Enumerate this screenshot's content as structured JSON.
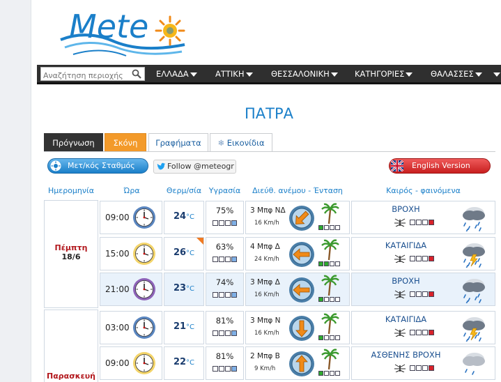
{
  "logo": {
    "text": "Mete"
  },
  "search": {
    "placeholder": "Αναζήτηση περιοχής"
  },
  "nav": {
    "items": [
      "ΕΛΛΑΔΑ",
      "ΑΤΤΙΚΗ",
      "ΘΕΣΣΑΛΟΝΙΚΗ",
      "ΚΑΤΗΓΟΡΙΕΣ",
      "ΘΑΛΑΣΣΕΣ"
    ]
  },
  "city": "ΠΑΤΡΑ",
  "tabs": [
    "Πρόγνωση",
    "Σκόνη",
    "Γραφήματα",
    "Εικονίδια"
  ],
  "buttons": {
    "stations": "Μετ/κός Σταθμός",
    "twitter": "Follow @meteogr",
    "english": "English Version"
  },
  "headers": [
    "Ημερομηνία",
    "Ώρα",
    "Θερμ/σία",
    "Υγρασία",
    "Διεύθ. ανέμου - Ένταση",
    "Καιρός - φαινόμενα"
  ],
  "days": [
    {
      "name": "Πέμπτη",
      "date": "18/6"
    },
    {
      "name": "Παρασκευή",
      "date": ""
    }
  ],
  "temp_unit": "°C",
  "rows": [
    {
      "time": "09:00",
      "temp": "24",
      "humidity": "75%",
      "hum_level": 1,
      "wind": "3 Μπφ ΝΔ",
      "speed": "16 Km/h",
      "wind_dir": "ΝΔ",
      "wind_level": 1,
      "cond": "ΒΡΟΧΗ",
      "cond_level": 1,
      "icon": "rain-icon",
      "marker": false
    },
    {
      "time": "15:00",
      "temp": "26",
      "humidity": "63%",
      "hum_level": 1,
      "wind": "4 Μπφ Δ",
      "speed": "24 Km/h",
      "wind_dir": "Δ",
      "wind_level": 2,
      "cond": "ΚΑΤΑΙΓΙΔΑ",
      "cond_level": 1,
      "icon": "thunderstorm-icon",
      "marker": true
    },
    {
      "time": "21:00",
      "temp": "23",
      "humidity": "74%",
      "hum_level": 1,
      "wind": "3 Μπφ Δ",
      "speed": "16 Km/h",
      "wind_dir": "Δ",
      "wind_level": 1,
      "cond": "ΒΡΟΧΗ",
      "cond_level": 1,
      "icon": "rain-icon",
      "marker": false
    },
    {
      "time": "03:00",
      "temp": "21",
      "humidity": "81%",
      "hum_level": 1,
      "wind": "3 Μπφ Ν",
      "speed": "16 Km/h",
      "wind_dir": "Ν",
      "wind_level": 1,
      "cond": "ΚΑΤΑΙΓΙΔΑ",
      "cond_level": 1,
      "icon": "thunderstorm-icon",
      "marker": false
    },
    {
      "time": "09:00",
      "temp": "22",
      "humidity": "81%",
      "hum_level": 1,
      "wind": "2 Μπφ Β",
      "speed": "9 Km/h",
      "wind_dir": "Β",
      "wind_level": 1,
      "cond": "ΑΣΘΕΝΗΣ ΒΡΟΧΗ",
      "cond_level": 1,
      "icon": "light-rain-icon",
      "marker": false
    }
  ],
  "colors": {
    "brand": "#1a7fc9",
    "accent": "#f39a2a",
    "danger": "#d8222a",
    "nav": "#2f2f2f"
  }
}
